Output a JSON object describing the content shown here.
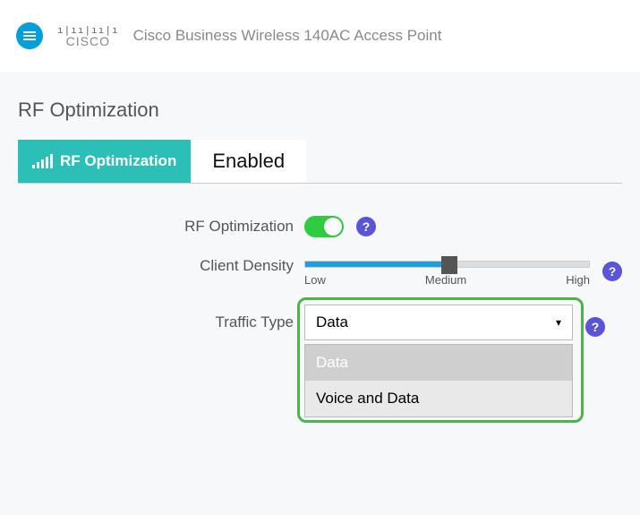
{
  "header": {
    "brand": "CISCO",
    "product_name": "Cisco Business Wireless 140AC Access Point"
  },
  "page": {
    "title": "RF Optimization",
    "tab_label": "RF Optimization",
    "state_label": "Enabled"
  },
  "form": {
    "rf_opt_label": "RF Optimization",
    "rf_opt_enabled": true,
    "client_density_label": "Client Density",
    "density_ticks": {
      "low": "Low",
      "medium": "Medium",
      "high": "High"
    },
    "traffic_type_label": "Traffic Type",
    "traffic_selected": "Data",
    "traffic_options": {
      "o0": "Data",
      "o1": "Voice and Data"
    }
  },
  "glyph": {
    "help": "?"
  }
}
